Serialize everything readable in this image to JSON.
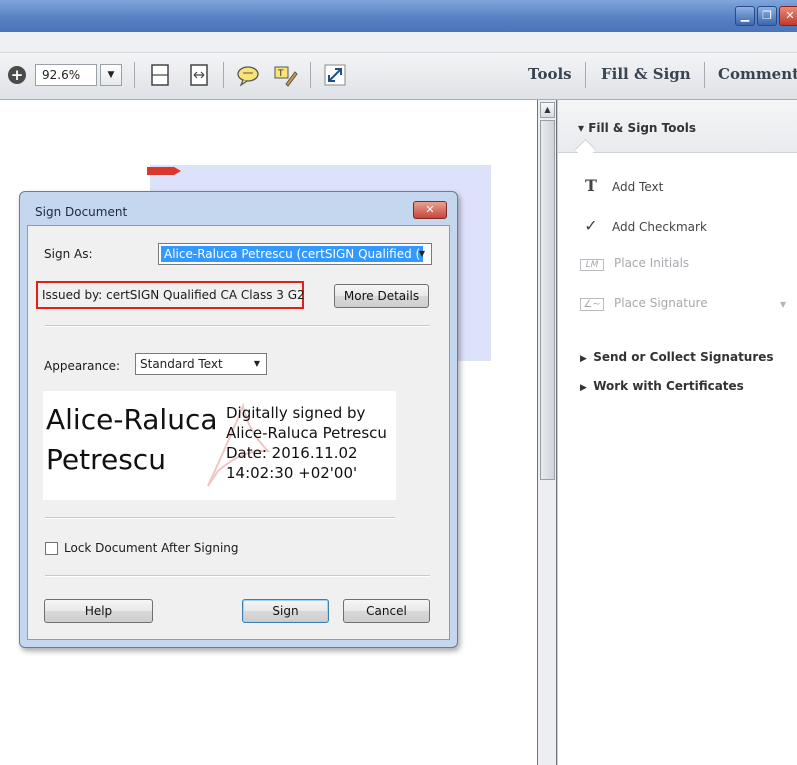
{
  "toolbar": {
    "zoom_value": "92.6%",
    "tools_label": "Tools",
    "fill_sign_label": "Fill & Sign",
    "comment_label": "Comment"
  },
  "right_panel": {
    "title": "Fill & Sign Tools",
    "items": [
      {
        "label": "Add Text",
        "icon": "text-icon",
        "enabled": true
      },
      {
        "label": "Add Checkmark",
        "icon": "checkmark-icon",
        "enabled": true
      },
      {
        "label": "Place Initials",
        "icon": "initials-icon",
        "enabled": false
      },
      {
        "label": "Place Signature",
        "icon": "signature-icon",
        "enabled": false
      }
    ],
    "sections": [
      {
        "label": "Send or Collect Signatures"
      },
      {
        "label": "Work with Certificates"
      }
    ]
  },
  "dialog": {
    "title": "Sign Document",
    "sign_as_label": "Sign As:",
    "sign_as_value": "Alice-Raluca Petrescu (certSIGN Qualified (",
    "issued_by": "Issued by: certSIGN Qualified CA Class 3 G2",
    "more_details_label": "More Details",
    "appearance_label": "Appearance:",
    "appearance_value": "Standard Text",
    "preview": {
      "name_line1": "Alice-Raluca",
      "name_line2": "Petrescu",
      "meta_line1": "Digitally signed by",
      "meta_line2": "Alice-Raluca Petrescu",
      "meta_line3": "Date: 2016.11.02",
      "meta_line4": "14:02:30 +02'00'"
    },
    "lock_label": "Lock Document After Signing",
    "lock_checked": false,
    "help_label": "Help",
    "sign_label": "Sign",
    "cancel_label": "Cancel",
    "highlight_color": "#e0201a"
  }
}
